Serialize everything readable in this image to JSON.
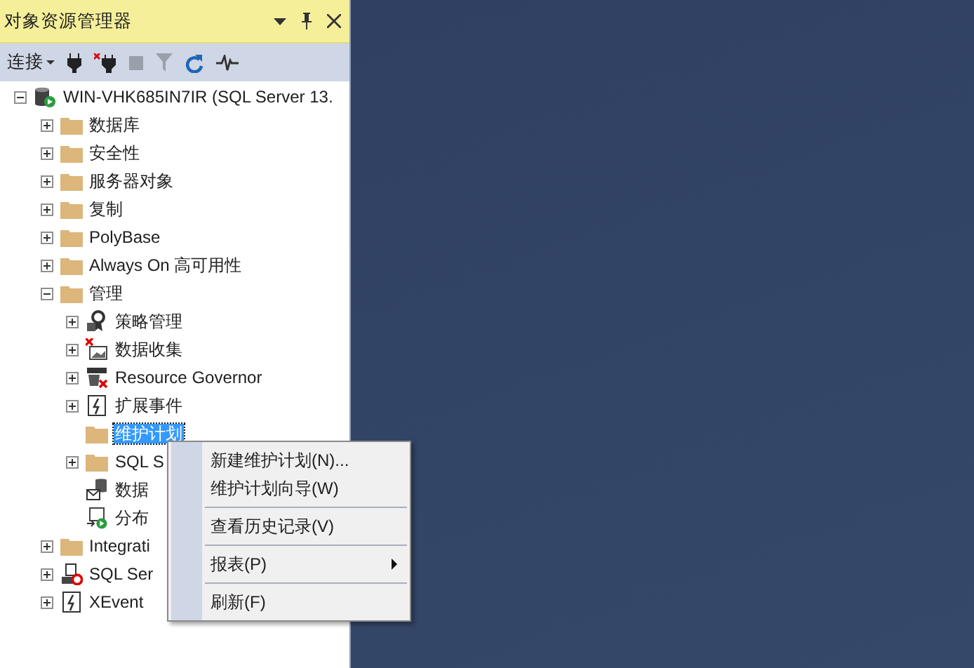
{
  "panel": {
    "title": "对象资源管理器",
    "title_buttons": [
      {
        "kind": "dropdown"
      },
      {
        "kind": "pin"
      },
      {
        "kind": "close"
      }
    ],
    "toolbar": {
      "connect_label": "连接",
      "tools": [
        {
          "kind": "connect",
          "disabled": false
        },
        {
          "kind": "disconnect",
          "disabled": false
        },
        {
          "kind": "stop",
          "disabled": true
        },
        {
          "kind": "filter",
          "disabled": true
        },
        {
          "kind": "refresh",
          "disabled": false
        },
        {
          "kind": "activity",
          "disabled": false
        }
      ]
    },
    "tree": [
      {
        "label": "WIN-VHK685IN7IR (SQL Server 13.",
        "kind": "server",
        "expanded": true,
        "selected": false,
        "children": [
          {
            "label": "数据库",
            "kind": "folder",
            "expanded": false,
            "selected": false
          },
          {
            "label": "安全性",
            "kind": "folder",
            "expanded": false,
            "selected": false
          },
          {
            "label": "服务器对象",
            "kind": "folder",
            "expanded": false,
            "selected": false
          },
          {
            "label": "复制",
            "kind": "folder",
            "expanded": false,
            "selected": false
          },
          {
            "label": "PolyBase",
            "kind": "folder",
            "expanded": false,
            "selected": false
          },
          {
            "label": "Always On 高可用性",
            "kind": "folder",
            "expanded": false,
            "selected": false
          },
          {
            "label": "管理",
            "kind": "folder",
            "expanded": true,
            "selected": false,
            "children": [
              {
                "label": "策略管理",
                "kind": "policy",
                "expanded": false,
                "selected": false
              },
              {
                "label": "数据收集",
                "kind": "collect",
                "expanded": false,
                "selected": false
              },
              {
                "label": "Resource Governor",
                "kind": "governor",
                "expanded": false,
                "selected": false
              },
              {
                "label": "扩展事件",
                "kind": "events",
                "expanded": false,
                "selected": false
              },
              {
                "label": "维护计划",
                "kind": "folder",
                "selected": true
              },
              {
                "label": "SQL S",
                "kind": "folder",
                "expanded": false,
                "selected": false
              },
              {
                "label": "数据",
                "kind": "mail",
                "selected": false
              },
              {
                "label": "分布",
                "kind": "distributed",
                "selected": false
              }
            ]
          },
          {
            "label": "Integrati",
            "kind": "folder",
            "expanded": false,
            "selected": false
          },
          {
            "label": "SQL Ser",
            "kind": "agent",
            "expanded": false,
            "selected": false
          },
          {
            "label": "XEvent",
            "kind": "events",
            "expanded": false,
            "selected": false
          }
        ]
      }
    ]
  },
  "context_menu": [
    {
      "kind": "item",
      "label": "新建维护计划(N)..."
    },
    {
      "kind": "item",
      "label": "维护计划向导(W)"
    },
    {
      "kind": "separator"
    },
    {
      "kind": "item",
      "label": "查看历史记录(V)"
    },
    {
      "kind": "separator"
    },
    {
      "kind": "submenu",
      "label": "报表(P)"
    },
    {
      "kind": "separator"
    },
    {
      "kind": "item",
      "label": "刷新(F)"
    }
  ]
}
